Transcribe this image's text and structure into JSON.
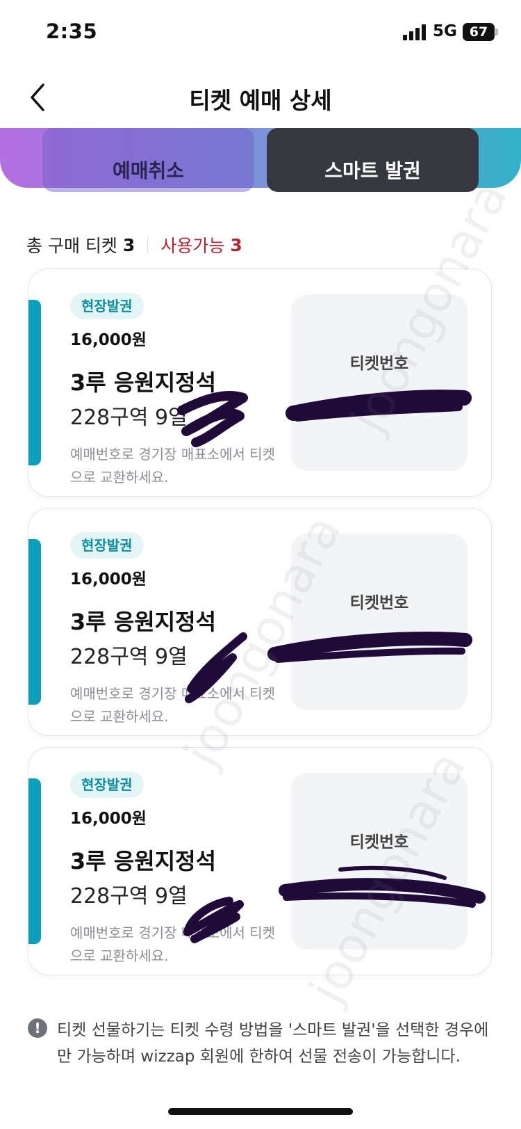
{
  "status_bar": {
    "time": "2:35",
    "network": "5G",
    "battery": "67"
  },
  "header": {
    "title": "티켓 예매 상세"
  },
  "banner": {
    "cancel_label": "예매취소",
    "smart_label": "스마트 발권"
  },
  "summary": {
    "total_label": "총 구매 티켓",
    "total_count": "3",
    "available_label": "사용가능",
    "available_count": "3"
  },
  "tickets": [
    {
      "tag": "현장발권",
      "price": "16,000원",
      "seat": "3루 응원지정석",
      "section": "228구역 9열",
      "note": "예매번호로 경기장 매표소에서 티켓으로 교환하세요.",
      "number_label": "티켓번호"
    },
    {
      "tag": "현장발권",
      "price": "16,000원",
      "seat": "3루 응원지정석",
      "section": "228구역 9열",
      "note": "예매번호로 경기장 매표소에서 티켓으로 교환하세요.",
      "number_label": "티켓번호"
    },
    {
      "tag": "현장발권",
      "price": "16,000원",
      "seat": "3루 응원지정석",
      "section": "228구역 9열",
      "note": "예매번호로 경기장 매표소에서 티켓으로 교환하세요.",
      "number_label": "티켓번호"
    }
  ],
  "notice": {
    "text": "티켓 선물하기는 티켓 수령 방법을 '스마트 발권'을 선택한 경우에만 가능하며 wizzap 회원에 한하여 선물 전송이 가능합니다."
  },
  "watermark": {
    "text": "joongonara"
  },
  "colors": {
    "accent": "#0ea0bb",
    "available": "#b3262f",
    "smart_button": "#36383f"
  }
}
